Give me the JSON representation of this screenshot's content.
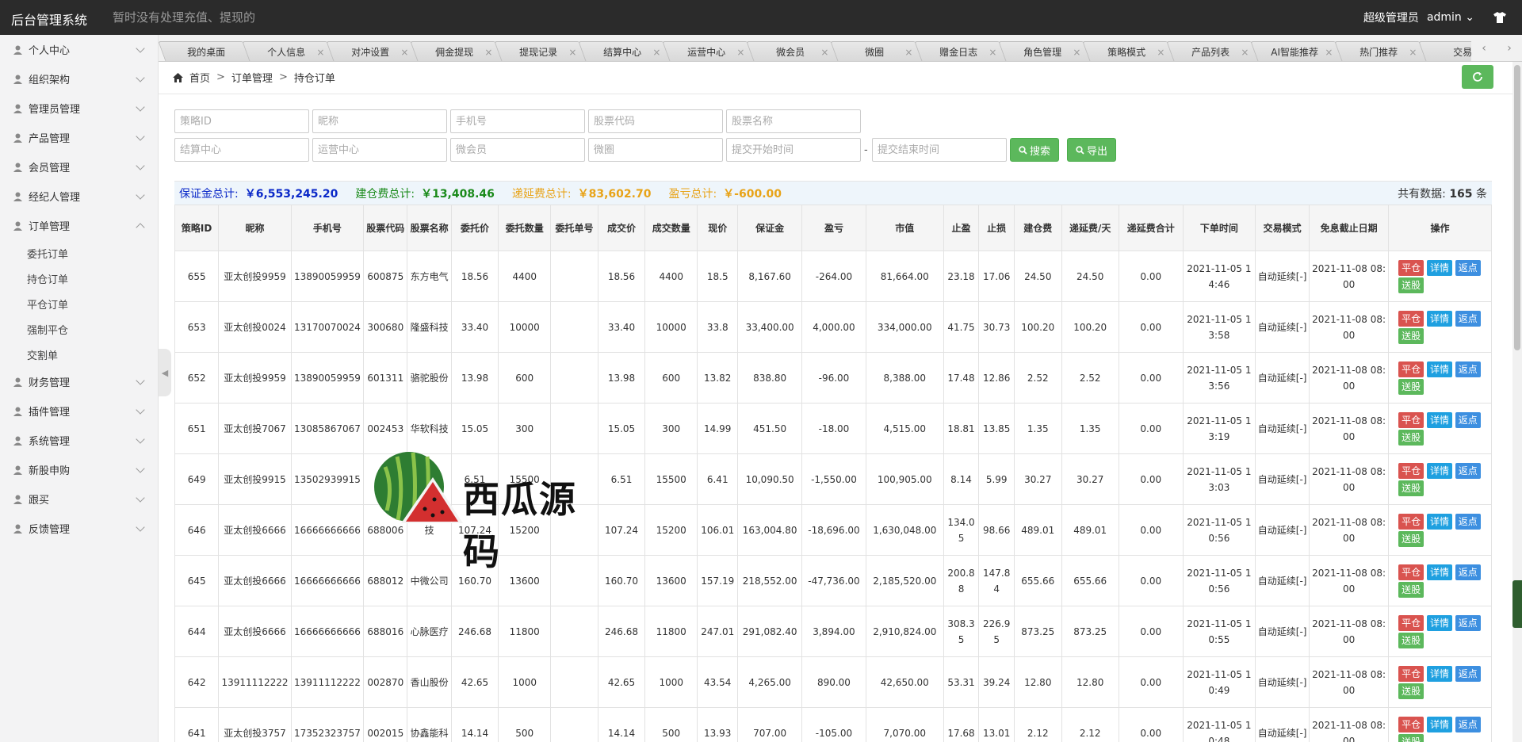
{
  "header": {
    "brand": "后台管理系统",
    "notice": "暂时没有处理充值、提现的",
    "role": "超级管理员",
    "user": "admin"
  },
  "sidebar": {
    "items": [
      {
        "label": "个人中心",
        "icon": "user-icon"
      },
      {
        "label": "组织架构",
        "icon": "org-icon"
      },
      {
        "label": "管理员管理",
        "icon": "user-icon"
      },
      {
        "label": "产品管理",
        "icon": "briefcase-icon"
      },
      {
        "label": "会员管理",
        "icon": "user-icon"
      },
      {
        "label": "经纪人管理",
        "icon": "tie-icon"
      },
      {
        "label": "订单管理",
        "icon": "document-icon",
        "expanded": true
      },
      {
        "label": "财务管理",
        "icon": "coin-icon"
      },
      {
        "label": "插件管理",
        "icon": "puzzle-icon"
      },
      {
        "label": "系统管理",
        "icon": "gear-icon"
      },
      {
        "label": "新股申购",
        "icon": "stock-icon"
      },
      {
        "label": "跟买",
        "icon": "follow-icon"
      },
      {
        "label": "反馈管理",
        "icon": "feedback-icon"
      }
    ],
    "order_subitems": [
      "委托订单",
      "持仓订单",
      "平仓订单",
      "强制平仓",
      "交割单"
    ]
  },
  "tabs": [
    "我的桌面",
    "个人信息",
    "对冲设置",
    "佣金提现",
    "提现记录",
    "结算中心",
    "运营中心",
    "微会员",
    "微圈",
    "赠金日志",
    "角色管理",
    "策略模式",
    "产品列表",
    "AI智能推荐",
    "热门推荐",
    "交易"
  ],
  "breadcrumb": [
    "首页",
    "订单管理",
    "持仓订单"
  ],
  "filters": {
    "row1": [
      "策略ID",
      "昵称",
      "手机号",
      "股票代码",
      "股票名称"
    ],
    "row2": [
      "结算中心",
      "运营中心",
      "微会员",
      "微圈",
      "提交开始时间"
    ],
    "end_time": "提交结束时间",
    "dash": "-",
    "search_label": "搜索",
    "export_label": "导出"
  },
  "summary": {
    "margin_label": "保证金总计:",
    "margin_value": "￥6,553,245.20",
    "open_fee_label": "建仓费总计:",
    "open_fee_value": "￥13,408.46",
    "deferred_label": "递延费总计:",
    "deferred_value": "￥83,602.70",
    "pnl_label": "盈亏总计:",
    "pnl_value": "￥-600.00",
    "total_label": "共有数据:",
    "total_value": "165",
    "total_unit": "条",
    "colors": {
      "margin": "#0a28c8",
      "open_fee": "#1a8a1a",
      "deferred": "#e8a317",
      "pnl": "#e8a317"
    }
  },
  "table": {
    "headers": [
      "策略ID",
      "昵称",
      "手机号",
      "股票代码",
      "股票名称",
      "委托价",
      "委托数量",
      "委托单号",
      "成交价",
      "成交数量",
      "现价",
      "保证金",
      "盈亏",
      "市值",
      "止盈",
      "止损",
      "建仓费",
      "递延费/天",
      "递延费合计",
      "下单时间",
      "交易模式",
      "免息截止日期",
      "操作"
    ],
    "ops": {
      "close": "平仓",
      "detail": "详情",
      "rebate": "返点",
      "gift": "送股"
    },
    "rows": [
      [
        "655",
        "亚太创投9959",
        "13890059959",
        "600875",
        "东方电气",
        "18.56",
        "4400",
        "",
        "18.56",
        "4400",
        "18.5",
        "8,167.60",
        "-264.00",
        "81,664.00",
        "23.18",
        "17.06",
        "24.50",
        "24.50",
        "0.00",
        "2021-11-05 14:46",
        "自动延续[-]",
        "2021-11-08 08:00"
      ],
      [
        "653",
        "亚太创投0024",
        "13170070024",
        "300680",
        "隆盛科技",
        "33.40",
        "10000",
        "",
        "33.40",
        "10000",
        "33.8",
        "33,400.00",
        "4,000.00",
        "334,000.00",
        "41.75",
        "30.73",
        "100.20",
        "100.20",
        "0.00",
        "2021-11-05 13:58",
        "自动延续[-]",
        "2021-11-08 08:00"
      ],
      [
        "652",
        "亚太创投9959",
        "13890059959",
        "601311",
        "骆驼股份",
        "13.98",
        "600",
        "",
        "13.98",
        "600",
        "13.82",
        "838.80",
        "-96.00",
        "8,388.00",
        "17.48",
        "12.86",
        "2.52",
        "2.52",
        "0.00",
        "2021-11-05 13:56",
        "自动延续[-]",
        "2021-11-08 08:00"
      ],
      [
        "651",
        "亚太创投7067",
        "13085867067",
        "002453",
        "华软科技",
        "15.05",
        "300",
        "",
        "15.05",
        "300",
        "14.99",
        "451.50",
        "-18.00",
        "4,515.00",
        "18.81",
        "13.85",
        "1.35",
        "1.35",
        "0.00",
        "2021-11-05 13:19",
        "自动延续[-]",
        "2021-11-08 08:00"
      ],
      [
        "649",
        "亚太创投9915",
        "13502939915",
        "30",
        "机",
        "6.51",
        "15500",
        "",
        "6.51",
        "15500",
        "6.41",
        "10,090.50",
        "-1,550.00",
        "100,905.00",
        "8.14",
        "5.99",
        "30.27",
        "30.27",
        "0.00",
        "2021-11-05 13:03",
        "自动延续[-]",
        "2021-11-08 08:00"
      ],
      [
        "646",
        "亚太创投6666",
        "16666666666",
        "688006",
        "技",
        "107.24",
        "15200",
        "",
        "107.24",
        "15200",
        "106.01",
        "163,004.80",
        "-18,696.00",
        "1,630,048.00",
        "134.05",
        "98.66",
        "489.01",
        "489.01",
        "0.00",
        "2021-11-05 10:56",
        "自动延续[-]",
        "2021-11-08 08:00"
      ],
      [
        "645",
        "亚太创投6666",
        "16666666666",
        "688012",
        "中微公司",
        "160.70",
        "13600",
        "",
        "160.70",
        "13600",
        "157.19",
        "218,552.00",
        "-47,736.00",
        "2,185,520.00",
        "200.88",
        "147.84",
        "655.66",
        "655.66",
        "0.00",
        "2021-11-05 10:56",
        "自动延续[-]",
        "2021-11-08 08:00"
      ],
      [
        "644",
        "亚太创投6666",
        "16666666666",
        "688016",
        "心脉医疗",
        "246.68",
        "11800",
        "",
        "246.68",
        "11800",
        "247.01",
        "291,082.40",
        "3,894.00",
        "2,910,824.00",
        "308.35",
        "226.95",
        "873.25",
        "873.25",
        "0.00",
        "2021-11-05 10:55",
        "自动延续[-]",
        "2021-11-08 08:00"
      ],
      [
        "642",
        "13911112222",
        "13911112222",
        "002870",
        "香山股份",
        "42.65",
        "1000",
        "",
        "42.65",
        "1000",
        "43.54",
        "4,265.00",
        "890.00",
        "42,650.00",
        "53.31",
        "39.24",
        "12.80",
        "12.80",
        "0.00",
        "2021-11-05 10:49",
        "自动延续[-]",
        "2021-11-08 08:00"
      ],
      [
        "641",
        "亚太创投3757",
        "17352323757",
        "002015",
        "协鑫能科",
        "14.14",
        "500",
        "",
        "14.14",
        "500",
        "13.93",
        "707.00",
        "-105.00",
        "7,070.00",
        "17.68",
        "13.01",
        "2.12",
        "2.12",
        "0.00",
        "2021-11-05 10:48",
        "自动延续[-]",
        "2021-11-08 08:00"
      ]
    ]
  },
  "watermark": {
    "text": "西瓜源码"
  }
}
